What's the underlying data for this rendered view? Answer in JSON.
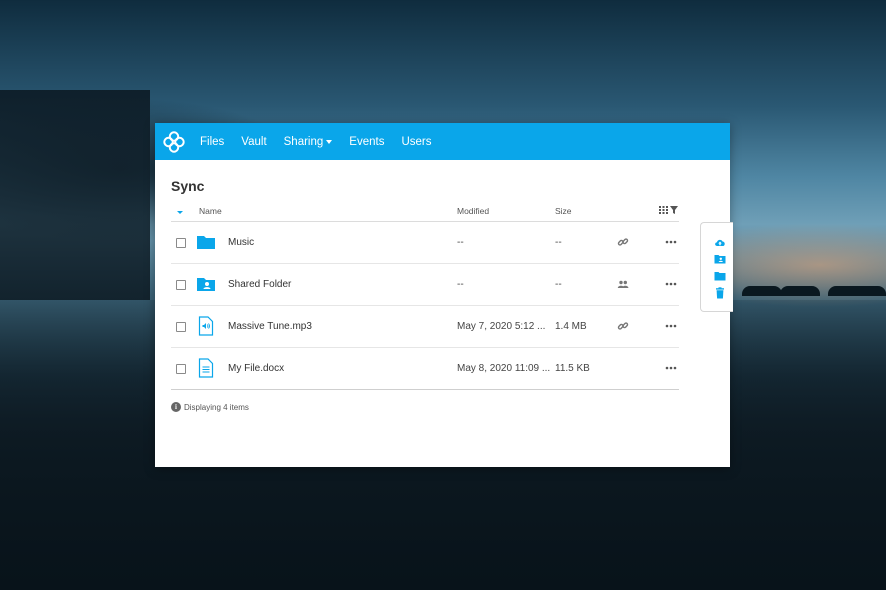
{
  "nav": {
    "items": [
      {
        "label": "Files"
      },
      {
        "label": "Vault"
      },
      {
        "label": "Sharing"
      },
      {
        "label": "Events"
      },
      {
        "label": "Users"
      }
    ]
  },
  "page": {
    "title": "Sync"
  },
  "table": {
    "columns": {
      "name": "Name",
      "modified": "Modified",
      "size": "Size"
    },
    "rows": [
      {
        "name": "Music",
        "modified": "--",
        "size": "--",
        "icon": "folder-icon",
        "share_icon": "link-icon"
      },
      {
        "name": "Shared Folder",
        "modified": "--",
        "size": "--",
        "icon": "shared-folder-icon",
        "share_icon": "users-icon"
      },
      {
        "name": "Massive Tune.mp3",
        "modified": "May 7, 2020 5:12 ...",
        "size": "1.4 MB",
        "icon": "audio-file-icon",
        "share_icon": "link-icon"
      },
      {
        "name": "My File.docx",
        "modified": "May 8, 2020 11:09 ...",
        "size": "11.5 KB",
        "icon": "document-file-icon",
        "share_icon": ""
      }
    ]
  },
  "footer": {
    "status": "Displaying 4 items"
  },
  "colors": {
    "accent": "#0aa6ea",
    "text": "#333333"
  }
}
